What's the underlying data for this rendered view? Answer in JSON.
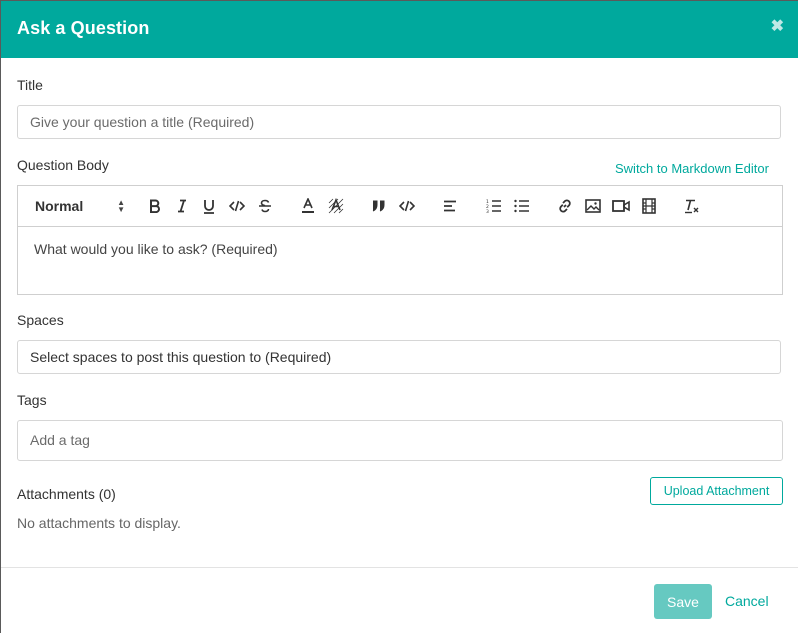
{
  "modal": {
    "title": "Ask a Question",
    "close_glyph": "✖"
  },
  "title_field": {
    "label": "Title",
    "placeholder": "Give your question a title (Required)",
    "value": ""
  },
  "body_field": {
    "label": "Question Body",
    "switch_link": "Switch to Markdown Editor",
    "format_select": "Normal",
    "placeholder": "What would you like to ask? (Required)",
    "toolbar_icons": [
      "bold-icon",
      "italic-icon",
      "underline-icon",
      "code-icon",
      "strikethrough-icon",
      "text-color-icon",
      "background-color-icon",
      "blockquote-icon",
      "code-block-icon",
      "align-icon",
      "ordered-list-icon",
      "bullet-list-icon",
      "link-icon",
      "image-icon",
      "video-icon",
      "film-icon",
      "clear-format-icon"
    ]
  },
  "spaces_field": {
    "label": "Spaces",
    "value": "Select spaces to post this question to (Required)"
  },
  "tags_field": {
    "label": "Tags",
    "placeholder": "Add a tag"
  },
  "attachments": {
    "label": "Attachments (0)",
    "upload_label": "Upload Attachment",
    "empty_text": "No attachments to display."
  },
  "footer": {
    "save_label": "Save",
    "cancel_label": "Cancel"
  },
  "colors": {
    "accent": "#00a99d",
    "save_disabled": "#66c9c1"
  }
}
